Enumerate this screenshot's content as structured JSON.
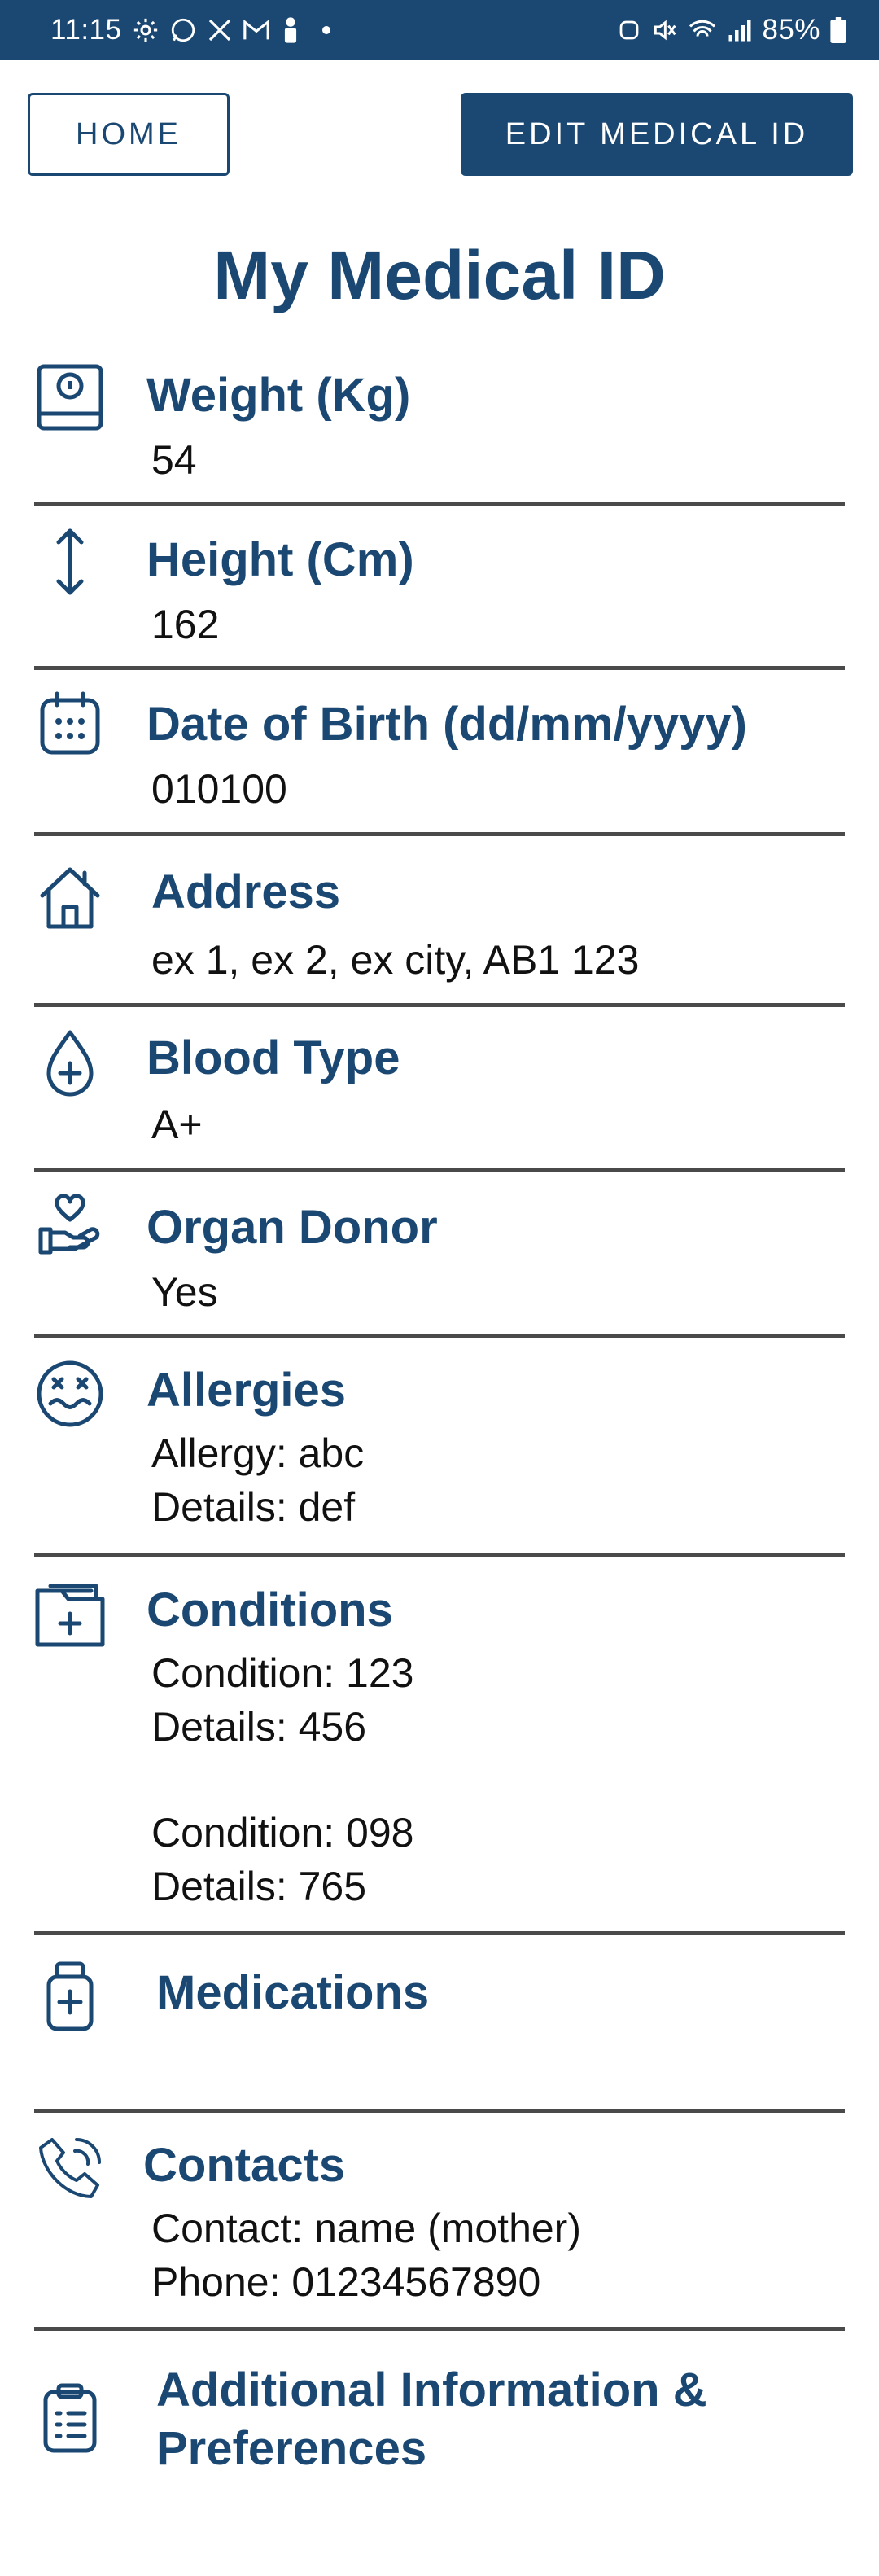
{
  "status_bar": {
    "time": "11:15",
    "battery": "85%"
  },
  "nav": {
    "home_label": "HOME",
    "edit_label": "EDIT MEDICAL ID"
  },
  "page_title": "My Medical ID",
  "sections": {
    "weight": {
      "label": "Weight (Kg)",
      "icon": "scale-icon",
      "value": "54"
    },
    "height": {
      "label": "Height (Cm)",
      "icon": "arrows-vertical-icon",
      "value": "162"
    },
    "dob": {
      "label": "Date of Birth (dd/mm/yyyy)",
      "icon": "calendar-icon",
      "value": "010100"
    },
    "address": {
      "label": "Address",
      "icon": "home-icon",
      "value": "ex 1, ex 2, ex city, AB1 123"
    },
    "blood_type": {
      "label": "Blood Type",
      "icon": "blood-drop-icon",
      "value": "A+"
    },
    "organ_donor": {
      "label": "Organ Donor",
      "icon": "hand-heart-icon",
      "value": "Yes"
    },
    "allergies": {
      "label": "Allergies",
      "icon": "dizzy-face-icon",
      "lines": [
        "Allergy: abc",
        "Details: def"
      ]
    },
    "conditions": {
      "label": "Conditions",
      "icon": "medical-folder-icon",
      "lines": [
        "Condition: 123",
        "Details: 456",
        "Condition: 098",
        "Details: 765"
      ]
    },
    "medications": {
      "label": "Medications",
      "icon": "medicine-bottle-icon"
    },
    "contacts": {
      "label": "Contacts",
      "icon": "phone-icon",
      "lines": [
        "Contact: name (mother)",
        "Phone: 01234567890"
      ]
    },
    "additional": {
      "label_line1": "Additional Information &",
      "label_line2": "Preferences",
      "icon": "clipboard-list-icon"
    }
  },
  "colors": {
    "brand": "#1b4872",
    "divider": "#4a4a4a",
    "text": "#111111"
  }
}
